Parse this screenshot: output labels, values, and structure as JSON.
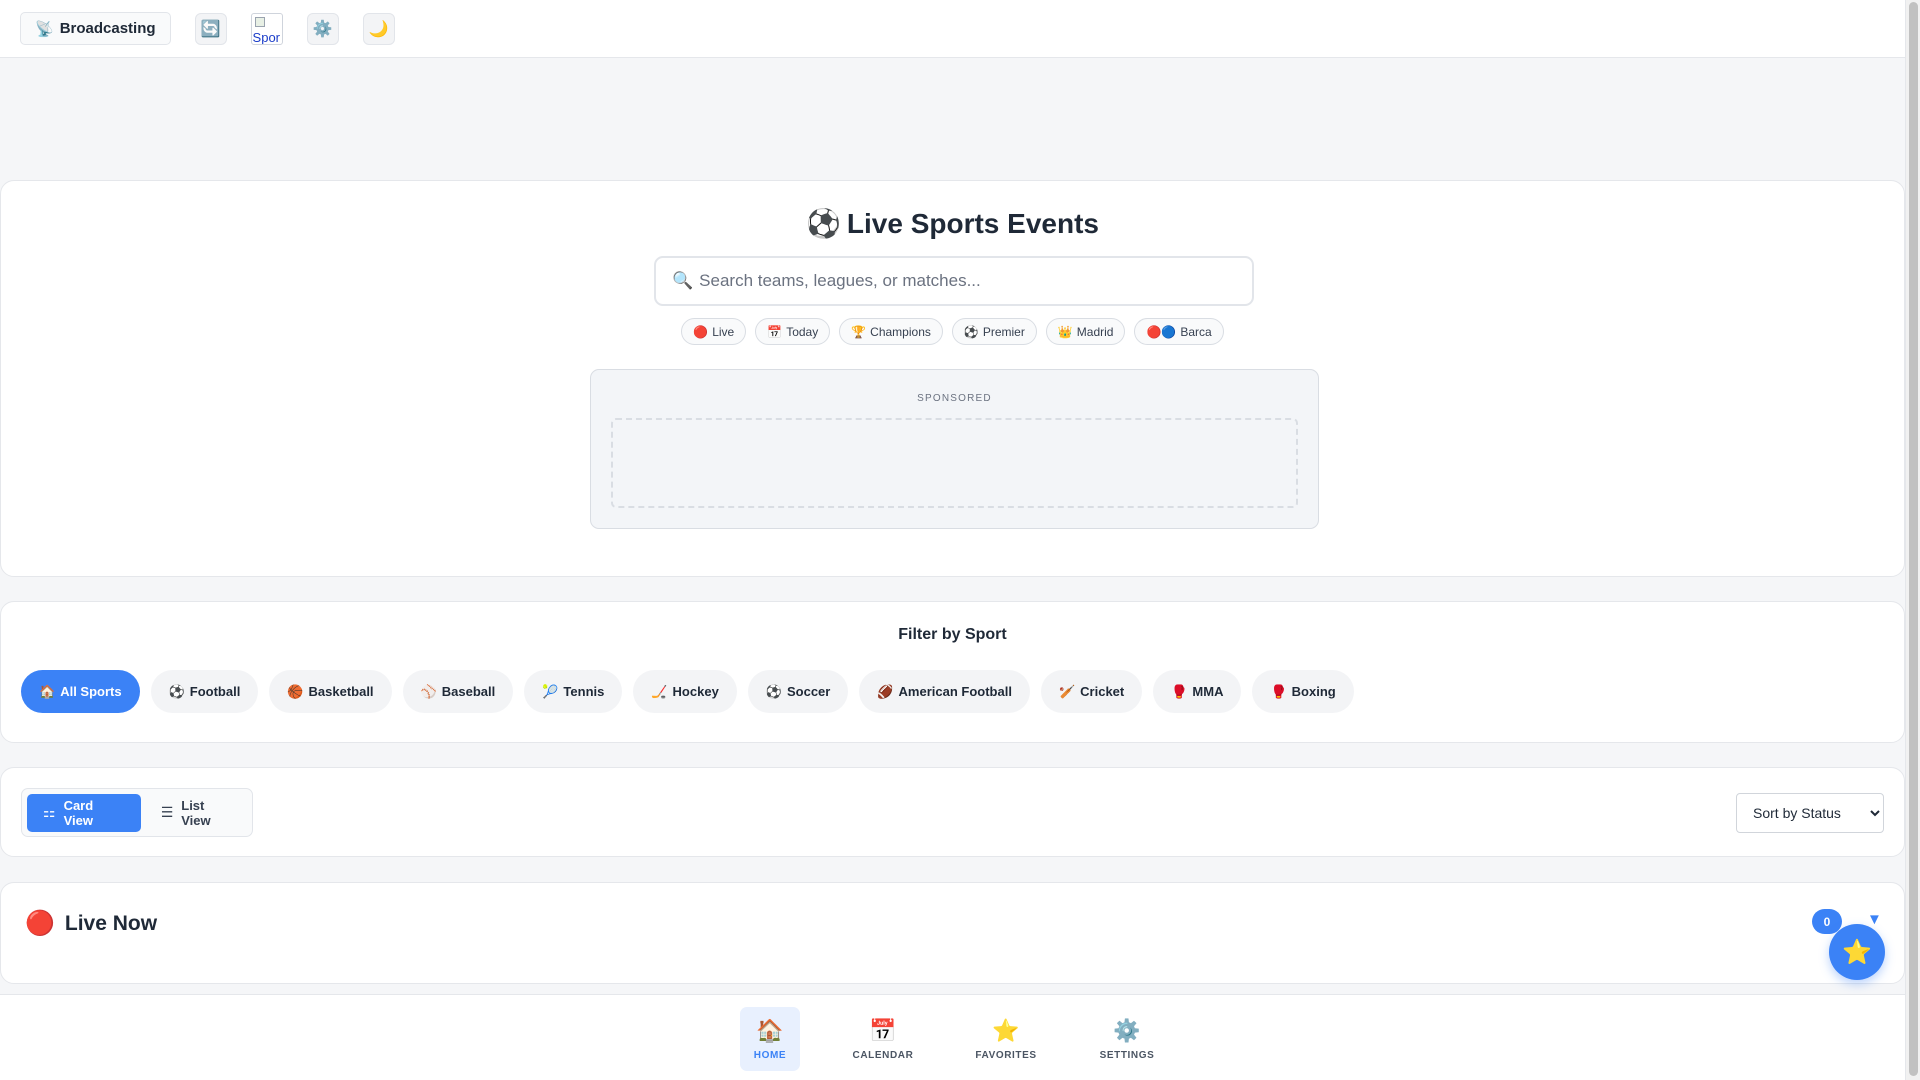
{
  "header": {
    "brand_icon": "📡",
    "brand_label": "Broadcasting",
    "refresh_icon": "🔄",
    "image_alt": "Spor",
    "settings_icon": "⚙️",
    "theme_icon": "🌙"
  },
  "hero": {
    "title_icon": "⚽",
    "title": "Live Sports Events",
    "search_icon": "🔍",
    "search_placeholder": "Search teams, leagues, or matches...",
    "quick_tags": [
      {
        "icon": "🔴",
        "label": "Live"
      },
      {
        "icon": "📅",
        "label": "Today"
      },
      {
        "icon": "🏆",
        "label": "Champions"
      },
      {
        "icon": "⚽",
        "label": "Premier"
      },
      {
        "icon": "👑",
        "label": "Madrid"
      },
      {
        "icon": "🔴🔵",
        "label": "Barca"
      }
    ],
    "sponsored_label": "SPONSORED"
  },
  "filters": {
    "title": "Filter by Sport",
    "chips": [
      {
        "icon": "🏠",
        "label": "All Sports"
      },
      {
        "icon": "⚽",
        "label": "Football"
      },
      {
        "icon": "🏀",
        "label": "Basketball"
      },
      {
        "icon": "⚾",
        "label": "Baseball"
      },
      {
        "icon": "🎾",
        "label": "Tennis"
      },
      {
        "icon": "🏒",
        "label": "Hockey"
      },
      {
        "icon": "⚽",
        "label": "Soccer"
      },
      {
        "icon": "🏈",
        "label": "American Football"
      },
      {
        "icon": "🏏",
        "label": "Cricket"
      },
      {
        "icon": "🥊",
        "label": "MMA"
      },
      {
        "icon": "🥊",
        "label": "Boxing"
      }
    ]
  },
  "view": {
    "card_icon": "⚏",
    "card_label": "Card View",
    "list_icon": "☰",
    "list_label": "List View",
    "sort_selected": "Sort by Status"
  },
  "live": {
    "icon": "🔴",
    "title": "Live Now",
    "count": "0",
    "caret": "▼"
  },
  "fab_icon": "⭐",
  "nav": [
    {
      "icon": "🏠",
      "label": "HOME"
    },
    {
      "icon": "📅",
      "label": "CALENDAR"
    },
    {
      "icon": "⭐",
      "label": "FAVORITES"
    },
    {
      "icon": "⚙️",
      "label": "SETTINGS"
    }
  ],
  "colors": {
    "accent": "#3b82f6",
    "background": "#f5f6f8",
    "card": "#ffffff"
  }
}
